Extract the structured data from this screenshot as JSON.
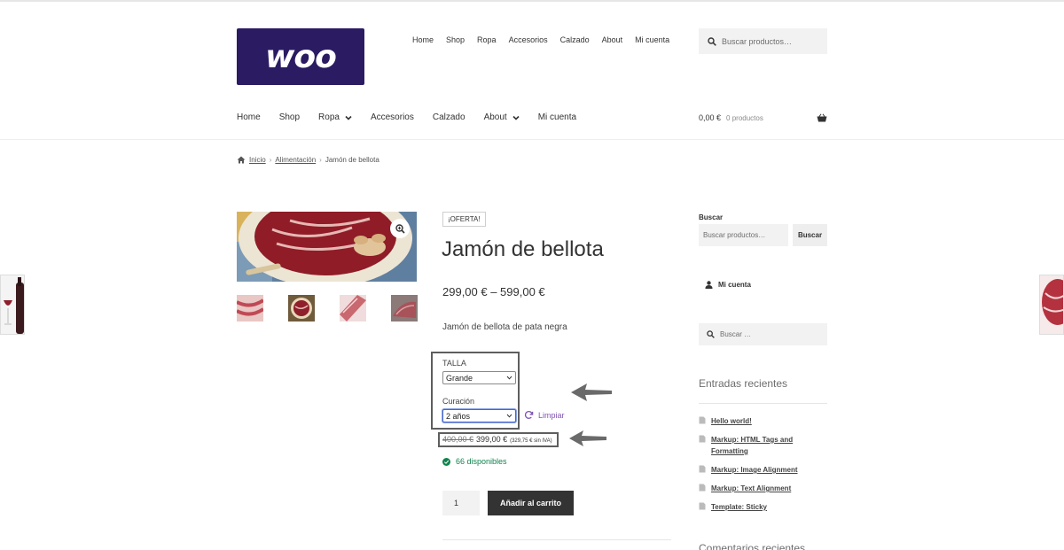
{
  "logo": {
    "text": "woo"
  },
  "secondary_nav": [
    "Home",
    "Shop",
    "Ropa",
    "Accesorios",
    "Calzado",
    "About",
    "Mi cuenta"
  ],
  "header_search": {
    "placeholder": "Buscar productos…"
  },
  "primary_nav": [
    {
      "label": "Home",
      "has_submenu": false
    },
    {
      "label": "Shop",
      "has_submenu": false
    },
    {
      "label": "Ropa",
      "has_submenu": true
    },
    {
      "label": "Accesorios",
      "has_submenu": false
    },
    {
      "label": "Calzado",
      "has_submenu": false
    },
    {
      "label": "About",
      "has_submenu": true
    },
    {
      "label": "Mi cuenta",
      "has_submenu": false
    }
  ],
  "cart": {
    "total": "0,00 €",
    "count": "0 productos"
  },
  "breadcrumb": {
    "home": "Inicio",
    "category": "Alimentación",
    "current": "Jamón de bellota"
  },
  "product": {
    "badge": "¡OFERTA!",
    "title": "Jamón de bellota",
    "price_range": "299,00 € – 599,00 €",
    "short_description": "Jamón de bellota de pata negra",
    "attributes": {
      "talla_label": "TALLA",
      "talla_value": "Grande",
      "curacion_label": "Curación",
      "curacion_value": "2 años",
      "clear_label": "Limpiar"
    },
    "variation_price": {
      "old": "400,00 €",
      "new": "399,00 €",
      "tax_note": "(329,75 € sin IVA)"
    },
    "stock": "66 disponibles",
    "quantity": "1",
    "add_to_cart": "Añadir al carrito"
  },
  "sidebar": {
    "search_title": "Buscar",
    "search_placeholder": "Buscar productos…",
    "search_button": "Buscar",
    "account_link": "Mi cuenta",
    "search2_placeholder": "Buscar …",
    "recent_posts_title": "Entradas recientes",
    "recent_posts": [
      "Hello world!",
      "Markup: HTML Tags and Formatting",
      "Markup: Image Alignment",
      "Markup: Text Alignment",
      "Template: Sticky"
    ],
    "recent_comments_title": "Comentarios recientes"
  },
  "colors": {
    "logo_bg": "#2b1b63",
    "button_dark": "#333333",
    "stock_green": "#0f834d",
    "link_purple": "#7f54b3",
    "annotation_gray": "#5e5e5e"
  }
}
